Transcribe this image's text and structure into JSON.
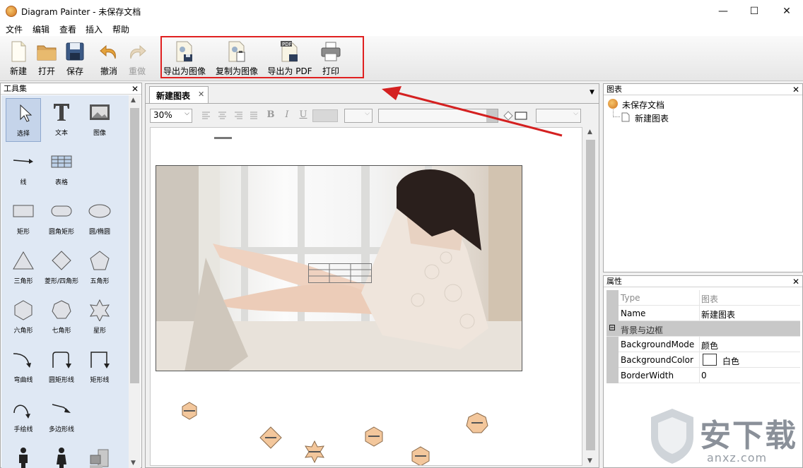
{
  "window": {
    "title": "Diagram Painter - 未保存文档",
    "minimize": "—",
    "maximize": "☐",
    "close": "✕"
  },
  "menu": [
    "文件",
    "编辑",
    "查看",
    "插入",
    "帮助"
  ],
  "toolbar": {
    "new": "新建",
    "open": "打开",
    "save": "保存",
    "undo": "撤消",
    "redo": "重做",
    "export_image": "导出为图像",
    "copy_image": "复制为图像",
    "export_pdf": "导出为 PDF",
    "print": "打印",
    "pdf_badge": "PDF"
  },
  "toolset": {
    "title": "工具集",
    "tools": [
      "选择",
      "文本",
      "图像",
      "线",
      "表格",
      "矩形",
      "圆角矩形",
      "圆/椭圆",
      "三角形",
      "菱形/四角形",
      "五角形",
      "六角形",
      "七角形",
      "星形",
      "弯曲线",
      "圆矩形线",
      "矩形线",
      "手绘线",
      "多边形线"
    ]
  },
  "document": {
    "tab": "新建图表",
    "zoom": "30%",
    "format_buttons": [
      "B",
      "I",
      "U"
    ]
  },
  "charts_panel": {
    "title": "图表",
    "root": "未保存文档",
    "child": "新建图表"
  },
  "props_panel": {
    "title": "属性",
    "rows": [
      {
        "key": "Type",
        "value": "图表"
      },
      {
        "key": "Name",
        "value": "新建图表"
      }
    ],
    "group": "背景与边框",
    "group_toggle": "⊟",
    "rows2": [
      {
        "key": "BackgroundMode",
        "value": "颜色"
      },
      {
        "key": "BackgroundColor",
        "value": "白色"
      },
      {
        "key": "BorderWidth",
        "value": "0"
      }
    ]
  },
  "watermark": {
    "big": "安下载",
    "small": "anxz.com"
  },
  "colors": {
    "accent_red": "#e02020",
    "arrow_red": "#d42020",
    "shape_fill": "#f3c79c"
  }
}
